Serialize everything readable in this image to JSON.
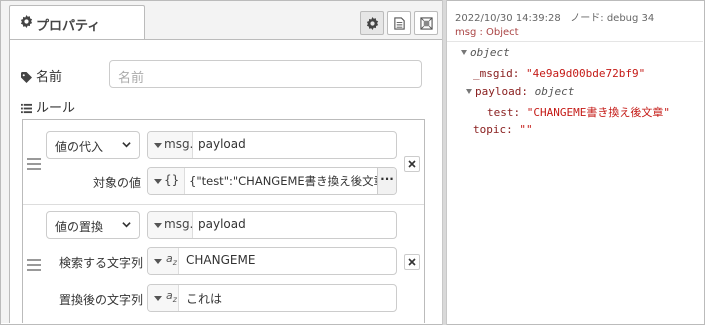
{
  "left_panel": {
    "tab_label": "プロパティ",
    "name": {
      "label": "名前",
      "placeholder": "名前"
    },
    "rules_label": "ルール",
    "rules": [
      {
        "action": "値の代入",
        "target_type": "msg.",
        "target_value": "payload",
        "source_label": "対象の値",
        "source_type": "{}",
        "source_value": "{\"test\":\"CHANGEME書き換え後文章\""
      },
      {
        "action": "値の置換",
        "target_type": "msg.",
        "target_value": "payload",
        "search_label": "検索する文字列",
        "search_value": "CHANGEME",
        "replace_label": "置換後の文字列",
        "replace_value": "これは"
      }
    ]
  },
  "debug": {
    "timestamp": "2022/10/30 14:39:28",
    "node": "ノード: debug 34",
    "msg_type": "msg : Object",
    "tree": {
      "root": "object",
      "msgid_key": "_msgid:",
      "msgid_val": "\"4e9a9d00bde72bf9\"",
      "payload_key": "payload:",
      "payload_type": "object",
      "test_key": "test:",
      "test_val": "\"CHANGEME書き換え後文章\"",
      "topic_key": "topic:",
      "topic_val": "\"\""
    }
  },
  "icons": [
    "gear-icon",
    "document-icon",
    "frame-icon",
    "tag-icon",
    "list-icon",
    "drag-handle-icon",
    "delete-icon",
    "chevron-down-icon"
  ],
  "colors": {
    "key": "#8a2020",
    "string": "#c41a16",
    "panel_bg": "#f3f3f3"
  }
}
